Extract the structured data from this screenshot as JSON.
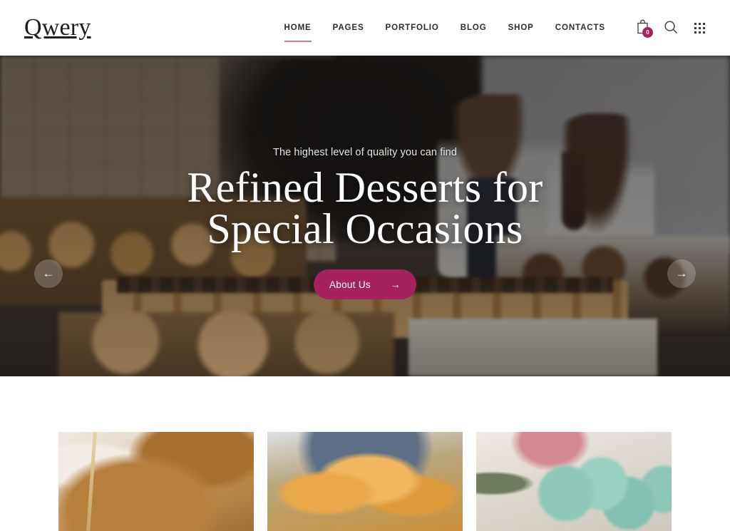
{
  "header": {
    "logo": "Qwery",
    "nav": [
      {
        "label": "HOME",
        "active": true
      },
      {
        "label": "PAGES",
        "active": false
      },
      {
        "label": "PORTFOLIO",
        "active": false
      },
      {
        "label": "BLOG",
        "active": false
      },
      {
        "label": "SHOP",
        "active": false
      },
      {
        "label": "CONTACTS",
        "active": false
      }
    ],
    "icons": {
      "cart": "cart-icon",
      "cart_count": "0",
      "search": "search-icon",
      "grid_menu": "grid-menu-icon"
    },
    "accent_underline_color": "#c97f84"
  },
  "hero": {
    "subtitle": "The highest level of quality you can find",
    "title_line1": "Refined Desserts for",
    "title_line2": "Special Occasions",
    "cta_label": "About Us",
    "cta_arrow": "→",
    "cta_color": "#a5225f",
    "prev_arrow": "←",
    "next_arrow": "→",
    "slides": [
      {
        "index": "1",
        "active": true
      },
      {
        "index": "2",
        "active": false
      },
      {
        "index": "3",
        "active": false
      }
    ],
    "active_dot_color": "#e2197a",
    "background_description": "bakery counter with bread rolls, pastries and two staff members"
  },
  "cards": [
    {
      "name": "sourdough-bread",
      "alt": "Rustic sourdough bread loaves on white cloth"
    },
    {
      "name": "croissants",
      "alt": "Basket of golden croissants and pastries"
    },
    {
      "name": "macarons",
      "alt": "Mint green macarons on a white plate with flowers"
    }
  ]
}
